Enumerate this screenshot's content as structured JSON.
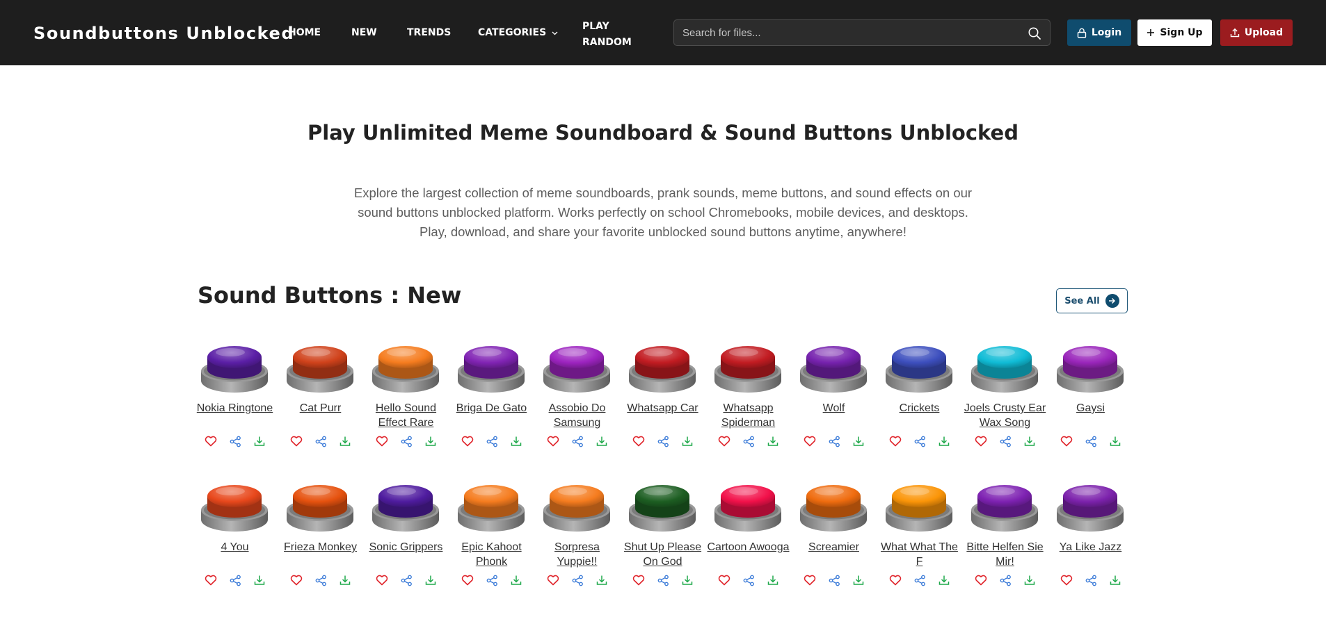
{
  "brand": "Soundbuttons Unblocked",
  "nav": {
    "home": "HOME",
    "new": "NEW",
    "trends": "TRENDS",
    "categories": "CATEGORIES",
    "play_random": "PLAY RANDOM"
  },
  "search": {
    "placeholder": "Search for files..."
  },
  "auth": {
    "login": "Login",
    "signup": "Sign Up",
    "upload": "Upload"
  },
  "hero": {
    "title": "Play Unlimited Meme Soundboard & Sound Buttons Unblocked",
    "description": "Explore the largest collection of meme soundboards, prank sounds, meme buttons, and sound effects on our sound buttons unblocked platform. Works perfectly on school Chromebooks, mobile devices, and desktops. Play, download, and share your favorite unblocked sound buttons anytime, anywhere!"
  },
  "section": {
    "title": "Sound Buttons : New",
    "see_all": "See All"
  },
  "colors": {
    "navbar": "#1e1e1e",
    "login": "#0f4c6e",
    "upload": "#9b1c1f",
    "like_icon": "#e0242b",
    "share_icon": "#3b7bd8",
    "download_icon": "#1fa84a"
  },
  "sounds": [
    {
      "name": "Nokia Ringtone",
      "color": "#5b1fa6"
    },
    {
      "name": "Cat Purr",
      "color": "#d0421b"
    },
    {
      "name": "Hello Sound Effect Rare",
      "color": "#f57c1f"
    },
    {
      "name": "Briga De Gato",
      "color": "#8124b4"
    },
    {
      "name": "Assobio Do Samsung",
      "color": "#9d24c0"
    },
    {
      "name": "Whatsapp Car",
      "color": "#c21c22"
    },
    {
      "name": "Whatsapp Spiderman",
      "color": "#c21c22"
    },
    {
      "name": "Wolf",
      "color": "#7622ae"
    },
    {
      "name": "Crickets",
      "color": "#3d4fbe"
    },
    {
      "name": "Joels Crusty Ear Wax Song",
      "color": "#10bcd6"
    },
    {
      "name": "Gaysi",
      "color": "#9a26bb"
    },
    {
      "name": "4 You",
      "color": "#e8481c"
    },
    {
      "name": "Frieza Monkey",
      "color": "#e6520f"
    },
    {
      "name": "Sonic Grippers",
      "color": "#4f1c9f"
    },
    {
      "name": "Epic Kahoot Phonk",
      "color": "#f57c1f"
    },
    {
      "name": "Sorpresa Yuppie!!",
      "color": "#f57c1f"
    },
    {
      "name": "Shut Up Please On God",
      "color": "#1d5e22"
    },
    {
      "name": "Cartoon Awooga",
      "color": "#f2114a"
    },
    {
      "name": "Screamier",
      "color": "#ef6c0f"
    },
    {
      "name": "What What The F",
      "color": "#fb9508"
    },
    {
      "name": "Bitte Helfen Sie Mir!",
      "color": "#7e22b2"
    },
    {
      "name": "Ya Like Jazz",
      "color": "#7c22ac"
    }
  ]
}
